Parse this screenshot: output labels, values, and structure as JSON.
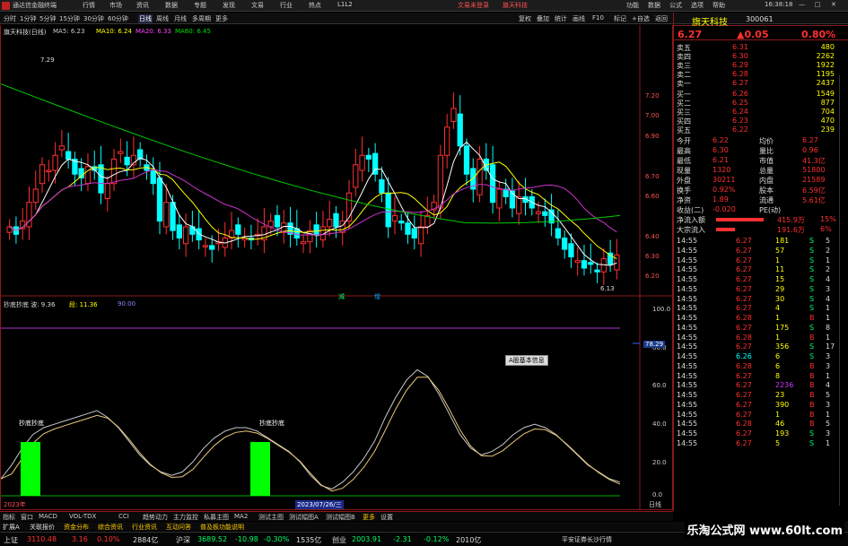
{
  "window": {
    "app_title": "通达信金融终端",
    "menu": [
      "行情",
      "市场",
      "资讯",
      "数据",
      "专题",
      "发现",
      "文易",
      "行业",
      "热点",
      "L1L2"
    ],
    "account_items": [
      "文易未登录",
      "旗天科技"
    ],
    "right_menu": [
      "功能",
      "数据",
      "公式",
      "选项",
      "帮助"
    ],
    "clock": "16:38:18"
  },
  "toolbar": {
    "periods": [
      "分时",
      "1分钟",
      "5分钟",
      "15分钟",
      "30分钟",
      "60分钟",
      "日线",
      "周线",
      "月线",
      "多周期",
      "更多"
    ],
    "active_period": "日线",
    "tools": [
      "复权",
      "叠加",
      "统计",
      "画线",
      "F10",
      "标记",
      "+自选",
      "返回"
    ]
  },
  "chart": {
    "stock_label": "旗天科技(日线)",
    "ma_legend": [
      {
        "text": "MA5: 6.23",
        "color": "#ffffff"
      },
      {
        "text": "MA10: 6.24",
        "color": "#ffff00"
      },
      {
        "text": "MA20: 6.33",
        "color": "#ff44ff"
      },
      {
        "text": "MA60: 6.45",
        "color": "#00dd00"
      }
    ],
    "high_label": "7.29",
    "low_label": "6.13",
    "price_ticks": [
      "7.20",
      "7.00",
      "6.90",
      "6.70",
      "6.60",
      "6.40",
      "6.30",
      "6.20"
    ],
    "vol_signs": [
      "减",
      "增"
    ],
    "indicator_legend": [
      "抄底抄底 波: 9.36",
      "段: 11.36",
      "90.00"
    ],
    "indicator_ticks": [
      "100.0",
      "80.0",
      "60.0",
      "40.0",
      "20.0",
      "0.0"
    ],
    "indicator_value": "78.29",
    "tooltip": "A股基本信息",
    "signal_labels": [
      "抄底抄底",
      "抄底抄底"
    ],
    "date_labels": [
      "2023年",
      "2023/07/26/三"
    ],
    "axis_unit": "日线"
  },
  "chart_data": {
    "type": "candlestick",
    "series_names": [
      "MA5",
      "MA10",
      "MA20",
      "MA60"
    ],
    "visible_range": {
      "high": 7.29,
      "low": 6.13
    }
  },
  "quote": {
    "name": "旗天科技",
    "code": "300061",
    "price": "6.27",
    "change": "▲0.05",
    "pct": "0.80%",
    "asks": [
      {
        "label": "卖五",
        "price": "6.31",
        "vol": "480"
      },
      {
        "label": "卖四",
        "price": "6.30",
        "vol": "2262"
      },
      {
        "label": "卖三",
        "price": "6.29",
        "vol": "1922"
      },
      {
        "label": "卖二",
        "price": "6.28",
        "vol": "1195"
      },
      {
        "label": "卖一",
        "price": "6.27",
        "vol": "2437"
      }
    ],
    "bids": [
      {
        "label": "买一",
        "price": "6.26",
        "vol": "1549"
      },
      {
        "label": "买二",
        "price": "6.25",
        "vol": "877"
      },
      {
        "label": "买三",
        "price": "6.24",
        "vol": "704"
      },
      {
        "label": "买四",
        "price": "6.23",
        "vol": "470"
      },
      {
        "label": "买五",
        "price": "6.22",
        "vol": "239"
      }
    ],
    "stats": [
      {
        "k1": "今开",
        "v1": "6.22",
        "k2": "均价",
        "v2": "6.27"
      },
      {
        "k1": "最高",
        "v1": "6.30",
        "k2": "量比",
        "v2": "0.96"
      },
      {
        "k1": "最低",
        "v1": "6.21",
        "k2": "市值",
        "v2": "41.3亿"
      },
      {
        "k1": "现量",
        "v1": "1320",
        "k2": "总量",
        "v2": "51800"
      },
      {
        "k1": "外盘",
        "v1": "30211",
        "k2": "内盘",
        "v2": "21589"
      },
      {
        "k1": "换手",
        "v1": "0.92%",
        "k2": "股本",
        "v2": "6.59亿"
      },
      {
        "k1": "净资",
        "v1": "1.89",
        "k2": "流通",
        "v2": "5.61亿"
      },
      {
        "k1": "收益(二)",
        "v1": "-0.020",
        "k2": "PE(动)",
        "v2": ""
      }
    ],
    "flows": [
      {
        "label": "净流入额",
        "value": "415.9万",
        "pct": "15%"
      },
      {
        "label": "大宗流入",
        "value": "191.6万",
        "pct": "6%"
      }
    ],
    "ticks": [
      {
        "t": "14:55",
        "p": "6.27",
        "v": "181",
        "d": "S",
        "n": "5"
      },
      {
        "t": "14:55",
        "p": "6.27",
        "v": "57",
        "d": "S",
        "n": "2"
      },
      {
        "t": "14:55",
        "p": "6.27",
        "v": "1",
        "d": "S",
        "n": "1"
      },
      {
        "t": "14:55",
        "p": "6.27",
        "v": "11",
        "d": "S",
        "n": "2"
      },
      {
        "t": "14:55",
        "p": "6.27",
        "v": "15",
        "d": "S",
        "n": "4"
      },
      {
        "t": "14:55",
        "p": "6.27",
        "v": "29",
        "d": "S",
        "n": "3"
      },
      {
        "t": "14:55",
        "p": "6.27",
        "v": "30",
        "d": "S",
        "n": "4"
      },
      {
        "t": "14:55",
        "p": "6.27",
        "v": "4",
        "d": "S",
        "n": "1"
      },
      {
        "t": "14:55",
        "p": "6.28",
        "v": "1",
        "d": "B",
        "n": "1"
      },
      {
        "t": "14:55",
        "p": "6.27",
        "v": "175",
        "d": "S",
        "n": "8"
      },
      {
        "t": "14:55",
        "p": "6.28",
        "v": "1",
        "d": "B",
        "n": "1"
      },
      {
        "t": "14:55",
        "p": "6.27",
        "v": "356",
        "d": "S",
        "n": "17"
      },
      {
        "t": "14:55",
        "p": "6.26",
        "v": "6",
        "d": "S",
        "n": "3"
      },
      {
        "t": "14:55",
        "p": "6.28",
        "v": "6",
        "d": "B",
        "n": "3"
      },
      {
        "t": "14:55",
        "p": "6.27",
        "v": "8",
        "d": "B",
        "n": "1"
      },
      {
        "t": "14:55",
        "p": "6.27",
        "v": "2236",
        "d": "B",
        "n": "4"
      },
      {
        "t": "14:55",
        "p": "6.27",
        "v": "23",
        "d": "B",
        "n": "5"
      },
      {
        "t": "14:55",
        "p": "6.27",
        "v": "390",
        "d": "B",
        "n": "3"
      },
      {
        "t": "14:55",
        "p": "6.27",
        "v": "1",
        "d": "B",
        "n": "1"
      },
      {
        "t": "14:55",
        "p": "6.28",
        "v": "46",
        "d": "B",
        "n": "5"
      },
      {
        "t": "14:55",
        "p": "6.27",
        "v": "193",
        "d": "S",
        "n": "3"
      },
      {
        "t": "14:55",
        "p": "6.27",
        "v": "5",
        "d": "S",
        "n": "1"
      }
    ]
  },
  "bottom_tabs": [
    "指标",
    "窗口",
    "MACD",
    "VOL-TDX",
    "CCI",
    "趋势动力",
    "主力监控",
    "私募主图",
    "MA2",
    "测试主图",
    "测试幅图A",
    "测试幅图B",
    "更多",
    "设置"
  ],
  "status_tabs": [
    "扩展A",
    "关联报价",
    "资金分布",
    "综合资讯",
    "行业资讯",
    "互动问答",
    "普及板功能说明"
  ],
  "index_bar": [
    {
      "name": "上证",
      "val": "3110.48",
      "chg": "3.16",
      "pct": "0.10%",
      "amt": "2884亿"
    },
    {
      "name": "沪深",
      "val": "3689.52",
      "chg": "-10.98",
      "pct": "-0.30%",
      "amt": "1535亿"
    },
    {
      "name": "创业",
      "val": "2003.91",
      "chg": "-2.31",
      "pct": "-0.12%",
      "amt": "2010亿"
    }
  ],
  "broker": "平安证券长沙行情",
  "watermark": "乐淘公式网 www.60lt.com",
  "colors": {
    "up": "#ff3030",
    "down": "#00ffff",
    "ma5": "#ffffff",
    "ma10": "#ffff00",
    "ma20": "#cc33cc",
    "ma60": "#00cc00",
    "accent": "#ffcc00"
  }
}
